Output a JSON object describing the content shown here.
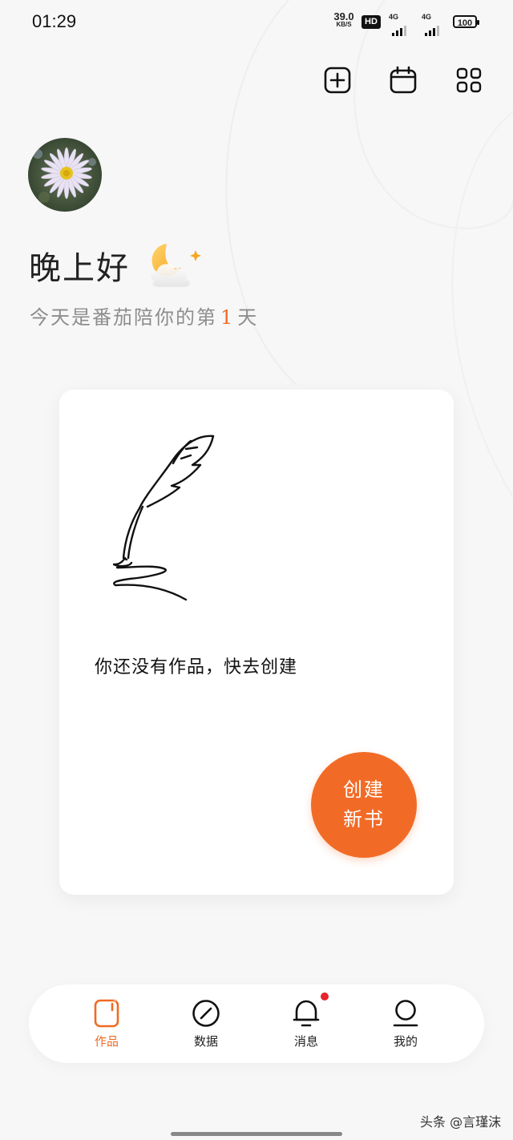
{
  "status_bar": {
    "time": "01:29",
    "net_speed": "39.0",
    "net_unit": "KB/S",
    "hd_badge": "HD",
    "signal_1": "4G",
    "signal_2": "4G",
    "battery": "100"
  },
  "top_actions": {
    "icons": [
      "add-square-icon",
      "calendar-icon",
      "grid-apps-icon"
    ]
  },
  "greeting": {
    "title": "晚上好",
    "weather_icon": "moon-cloud-icon",
    "subline_prefix": "今天是番茄陪你的第",
    "day_count": "1",
    "subline_suffix": "天"
  },
  "card": {
    "illustration": "quill-pen-icon",
    "empty_text": "你还没有作品，快去创建",
    "create_button": "创建新书"
  },
  "bottom_nav": {
    "items": [
      {
        "label": "作品",
        "icon": "works-icon",
        "active": true
      },
      {
        "label": "数据",
        "icon": "data-icon",
        "active": false
      },
      {
        "label": "消息",
        "icon": "bell-icon",
        "active": false
      },
      {
        "label": "我的",
        "icon": "profile-icon",
        "active": false
      }
    ]
  },
  "watermark": "头条 @言瑾沫",
  "colors": {
    "accent": "#f26b26",
    "badge": "#e8242c",
    "background": "#f7f7f7"
  }
}
